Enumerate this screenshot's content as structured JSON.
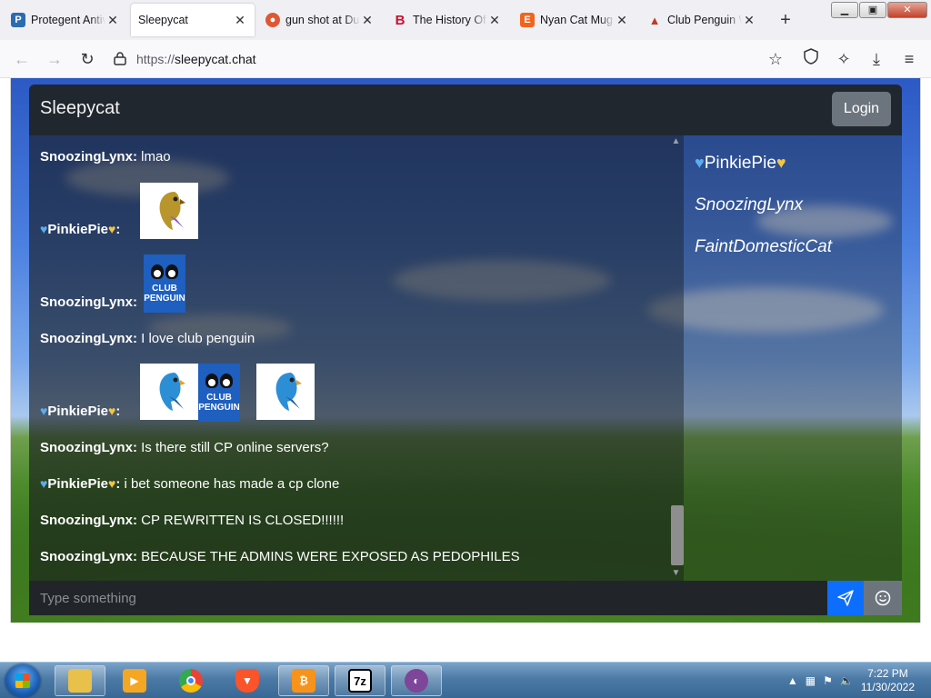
{
  "browser": {
    "tabs": [
      {
        "title": "Protegent Antiv",
        "favicon": "protegent-icon",
        "active": false
      },
      {
        "title": "Sleepycat",
        "favicon": "",
        "active": true
      },
      {
        "title": "gun shot at Duc",
        "favicon": "duckduckgo-icon",
        "active": false
      },
      {
        "title": "The History Of",
        "favicon": "bold-b-icon",
        "active": false
      },
      {
        "title": "Nyan Cat Mug",
        "favicon": "etsy-icon",
        "active": false
      },
      {
        "title": "Club Penguin W",
        "favicon": "club-penguin-icon",
        "active": false
      }
    ],
    "url_prefix": "https://",
    "url_host": "sleepycat.chat"
  },
  "app": {
    "brand": "Sleepycat",
    "login_label": "Login",
    "input_placeholder": "Type something"
  },
  "messages": [
    {
      "author": "SnoozingLynx",
      "separator": ":",
      "text": "lmao",
      "hearts": false
    },
    {
      "author": "PinkiePie",
      "separator": ":",
      "text": "",
      "hearts": true,
      "emotes": [
        "blue-parrot-emote"
      ]
    },
    {
      "author": "SnoozingLynx",
      "separator": ":",
      "text": "",
      "hearts": false,
      "emotes": [
        "club-penguin-emote"
      ]
    },
    {
      "author": "SnoozingLynx",
      "separator": ":",
      "text": "I love club penguin",
      "hearts": false
    },
    {
      "author": "PinkiePie",
      "separator": ":",
      "text": "",
      "hearts": true,
      "emotes": [
        "blue-parrot-emote",
        "club-penguin-emote",
        "blue-parrot-emote"
      ]
    },
    {
      "author": "SnoozingLynx",
      "separator": ":",
      "text": "Is there still CP online servers?",
      "hearts": false
    },
    {
      "author": "PinkiePie",
      "separator": ":",
      "text": "i bet someone has made a cp clone",
      "hearts": true
    },
    {
      "author": "SnoozingLynx",
      "separator": ":",
      "text": "CP REWRITTEN IS CLOSED!!!!!!",
      "hearts": false
    },
    {
      "author": "SnoozingLynx",
      "separator": ":",
      "text": "BECAUSE THE ADMINS WERE EXPOSED AS PEDOPHILES",
      "hearts": false
    }
  ],
  "emote_text": {
    "club": "CLUB",
    "penguin": "PENGUIN"
  },
  "users": [
    {
      "name": "PinkiePie",
      "hearts": true,
      "italic": false
    },
    {
      "name": "SnoozingLynx",
      "hearts": false,
      "italic": true
    },
    {
      "name": "FaintDomesticCat",
      "hearts": false,
      "italic": true
    }
  ],
  "taskbar": {
    "time": "7:22 PM",
    "date": "11/30/2022",
    "apps": [
      "file-explorer-icon",
      "media-player-icon",
      "chrome-icon",
      "brave-icon",
      "bitcoin-wallet-icon",
      "7zip-icon",
      "tor-browser-icon"
    ],
    "sevenzip_label": "7z"
  },
  "colors": {
    "accent": "#0d6efd",
    "heart_blue": "#5aaef0",
    "heart_yellow": "#f4c542",
    "panel": "#212529"
  }
}
